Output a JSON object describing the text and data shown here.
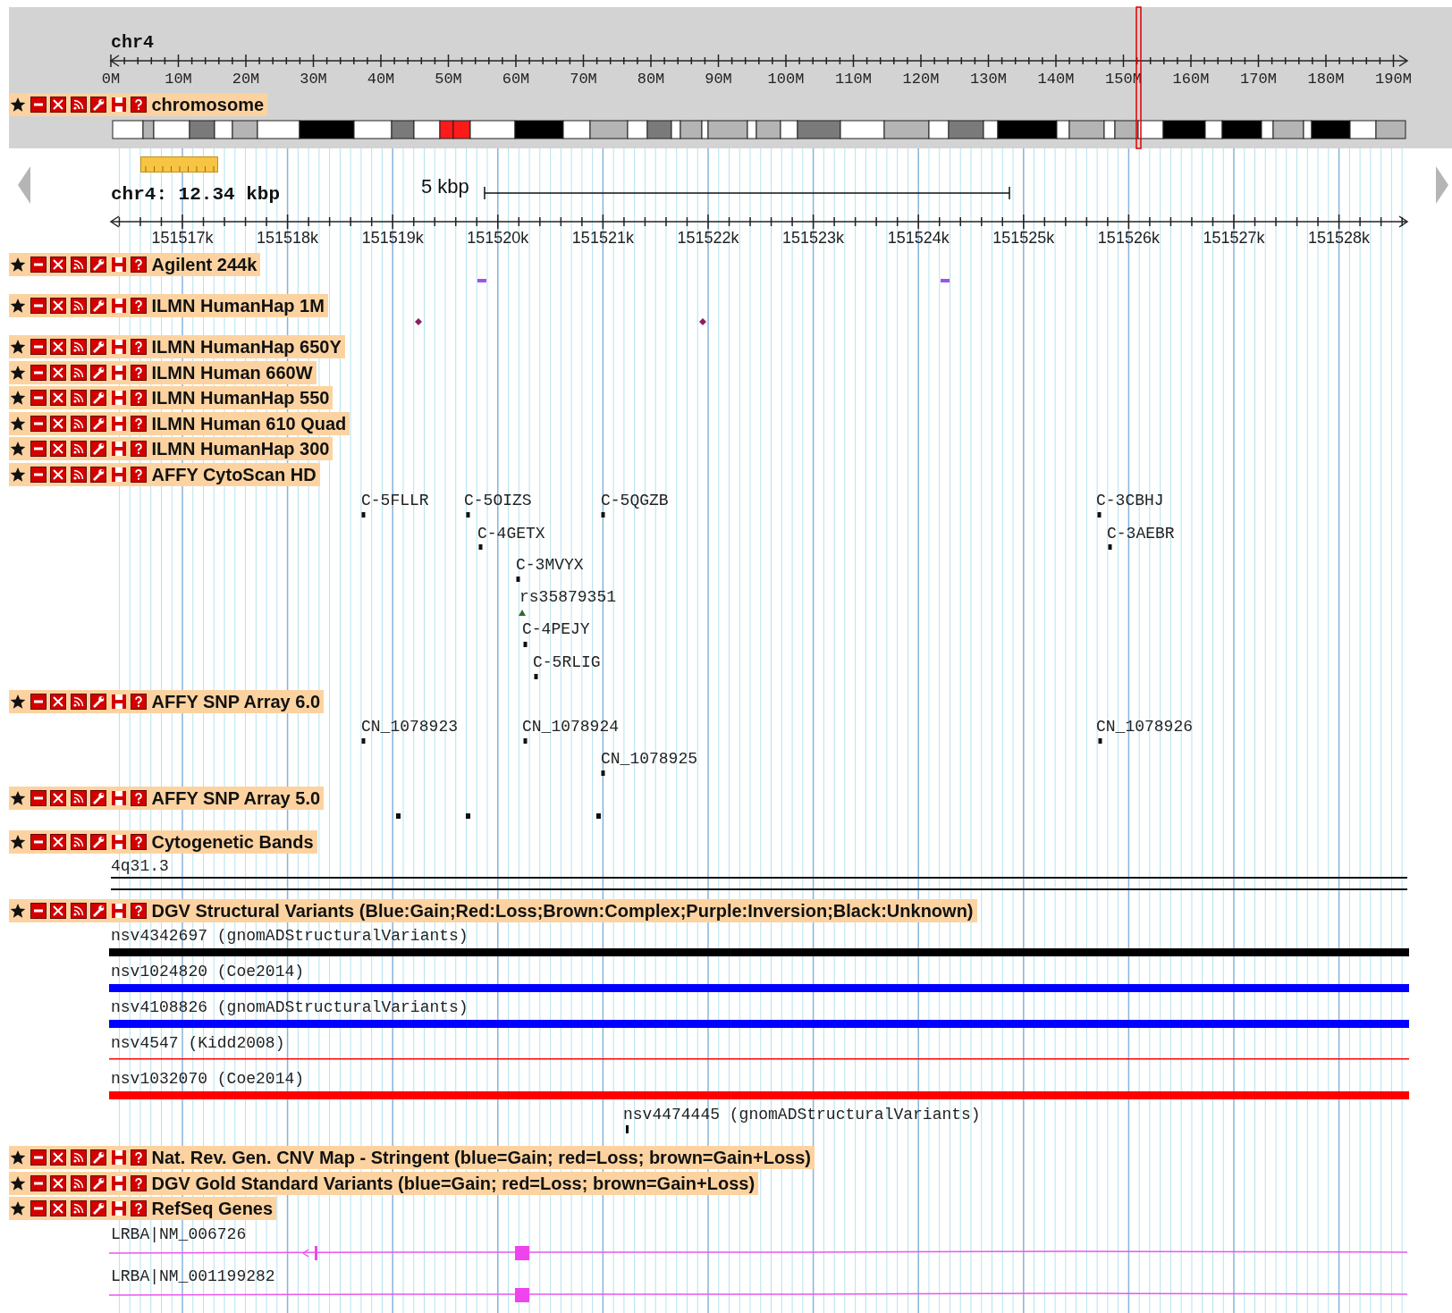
{
  "overview": {
    "chromosome": "chr4",
    "ticks": [
      "0M",
      "10M",
      "20M",
      "30M",
      "40M",
      "50M",
      "60M",
      "70M",
      "80M",
      "90M",
      "100M",
      "110M",
      "120M",
      "130M",
      "140M",
      "150M",
      "160M",
      "170M",
      "180M",
      "190M"
    ],
    "track": {
      "title": "chromosome"
    }
  },
  "details": {
    "region": "chr4: 12.34 kbp",
    "scale": "5 kbp",
    "ticks": [
      "151517k",
      "151518k",
      "151519k",
      "151520k",
      "151521k",
      "151522k",
      "151523k",
      "151524k",
      "151525k",
      "151526k",
      "151527k",
      "151528k"
    ]
  },
  "tracks": [
    {
      "title": "Agilent 244k",
      "kind": "dash"
    },
    {
      "title": "ILMN HumanHap 1M",
      "kind": "diamond"
    },
    {
      "title": "ILMN HumanHap 650Y",
      "kind": "empty"
    },
    {
      "title": "ILMN Human 660W",
      "kind": "empty"
    },
    {
      "title": "ILMN HumanHap 550",
      "kind": "empty"
    },
    {
      "title": "ILMN Human 610 Quad",
      "kind": "empty"
    },
    {
      "title": "ILMN HumanHap 300",
      "kind": "empty"
    },
    {
      "title": "AFFY CytoScan HD",
      "kind": "labeled",
      "features": [
        {
          "label": "C-5FLLR",
          "kind": "probe"
        },
        {
          "label": "C-5OIZS",
          "kind": "probe"
        },
        {
          "label": "C-5QGZB",
          "kind": "probe"
        },
        {
          "label": "C-3CBHJ",
          "kind": "probe"
        },
        {
          "label": "C-4GETX",
          "kind": "probe"
        },
        {
          "label": "C-3AEBR",
          "kind": "probe"
        },
        {
          "label": "C-3MVYX",
          "kind": "probe"
        },
        {
          "label": "rs35879351",
          "kind": "snp"
        },
        {
          "label": "C-4PEJY",
          "kind": "probe"
        },
        {
          "label": "C-5RLIG",
          "kind": "probe"
        }
      ]
    },
    {
      "title": "AFFY SNP Array 6.0",
      "kind": "labeled",
      "features": [
        {
          "label": "CN_1078923",
          "kind": "probe"
        },
        {
          "label": "CN_1078924",
          "kind": "probe"
        },
        {
          "label": "CN_1078926",
          "kind": "probe"
        },
        {
          "label": "CN_1078925",
          "kind": "probe"
        }
      ]
    },
    {
      "title": "AFFY SNP Array 5.0",
      "kind": "dot"
    },
    {
      "title": "Cytogenetic Bands",
      "kind": "bands",
      "band": "4q31.3"
    },
    {
      "title": "DGV Structural Variants (Blue:Gain;Red:Loss;Brown:Complex;Purple:Inversion;Black:Unknown)",
      "kind": "variants",
      "variants": [
        {
          "label": "nsv4342697 (gnomADStructuralVariants)",
          "kind": "bar",
          "color": "#000000"
        },
        {
          "label": "nsv1024820 (Coe2014)",
          "kind": "bar",
          "color": "#0000ff"
        },
        {
          "label": "nsv4108826 (gnomADStructuralVariants)",
          "kind": "bar",
          "color": "#0000ff"
        },
        {
          "label": "nsv4547 (Kidd2008)",
          "kind": "line",
          "color": "#ff0000"
        },
        {
          "label": "nsv1032070 (Coe2014)",
          "kind": "bar",
          "color": "#ff0000"
        },
        {
          "label": "nsv4474445 (gnomADStructuralVariants)",
          "kind": "tick",
          "color": "#000000"
        }
      ]
    },
    {
      "title": "Nat. Rev. Gen. CNV Map - Stringent (blue=Gain; red=Loss; brown=Gain+Loss)",
      "kind": "empty"
    },
    {
      "title": "DGV Gold Standard Variants (blue=Gain; red=Loss; brown=Gain+Loss)",
      "kind": "empty"
    },
    {
      "title": "RefSeq Genes",
      "kind": "genes",
      "genes": [
        {
          "label": "LRBA|NM_006726"
        },
        {
          "label": "LRBA|NM_001199282"
        }
      ]
    }
  ]
}
